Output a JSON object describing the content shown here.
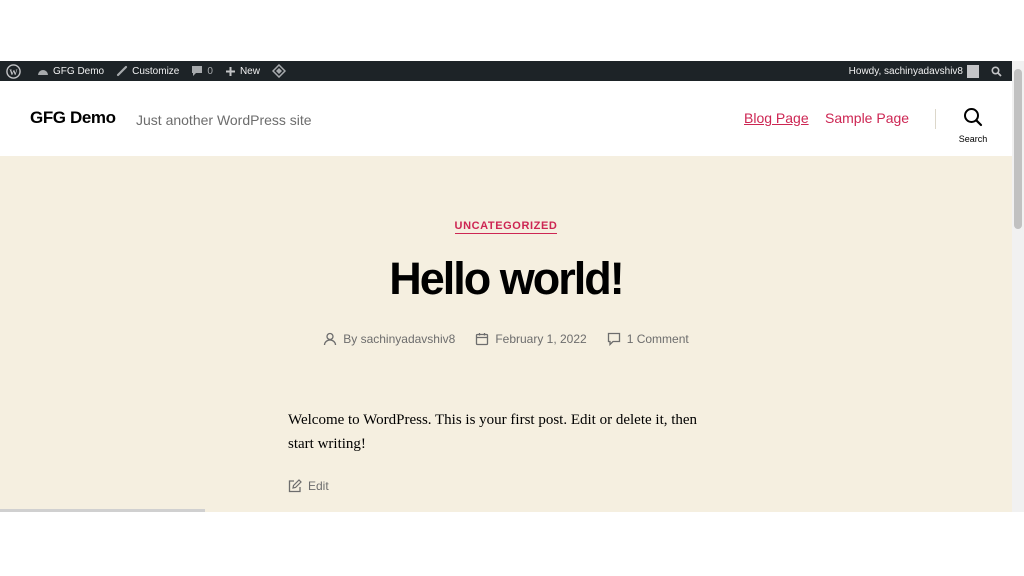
{
  "adminbar": {
    "site_name": "GFG Demo",
    "customize": "Customize",
    "comments_count": "0",
    "new_label": "New",
    "howdy": "Howdy, sachinyadavshiv8",
    "icons": [
      "wordpress-logo-icon",
      "dashboard-icon",
      "brush-icon",
      "comment-icon",
      "plus-icon",
      "diamond-icon",
      "avatar-icon",
      "search-icon"
    ]
  },
  "header": {
    "site_title": "GFG Demo",
    "site_description": "Just another WordPress site",
    "nav": [
      "Blog Page",
      "Sample Page"
    ],
    "search_label": "Search"
  },
  "post": {
    "category": "UNCATEGORIZED",
    "title": "Hello world!",
    "author": "By sachinyadavshiv8",
    "date": "February 1, 2022",
    "comments": "1 Comment",
    "content_line1": "Welcome to WordPress. This is your first post. Edit or delete it, then",
    "content_line2": "start writing!",
    "edit_label": "Edit"
  },
  "colors": {
    "accent": "#cd2653",
    "background": "#f5efe0",
    "adminbar": "#1d2327"
  }
}
